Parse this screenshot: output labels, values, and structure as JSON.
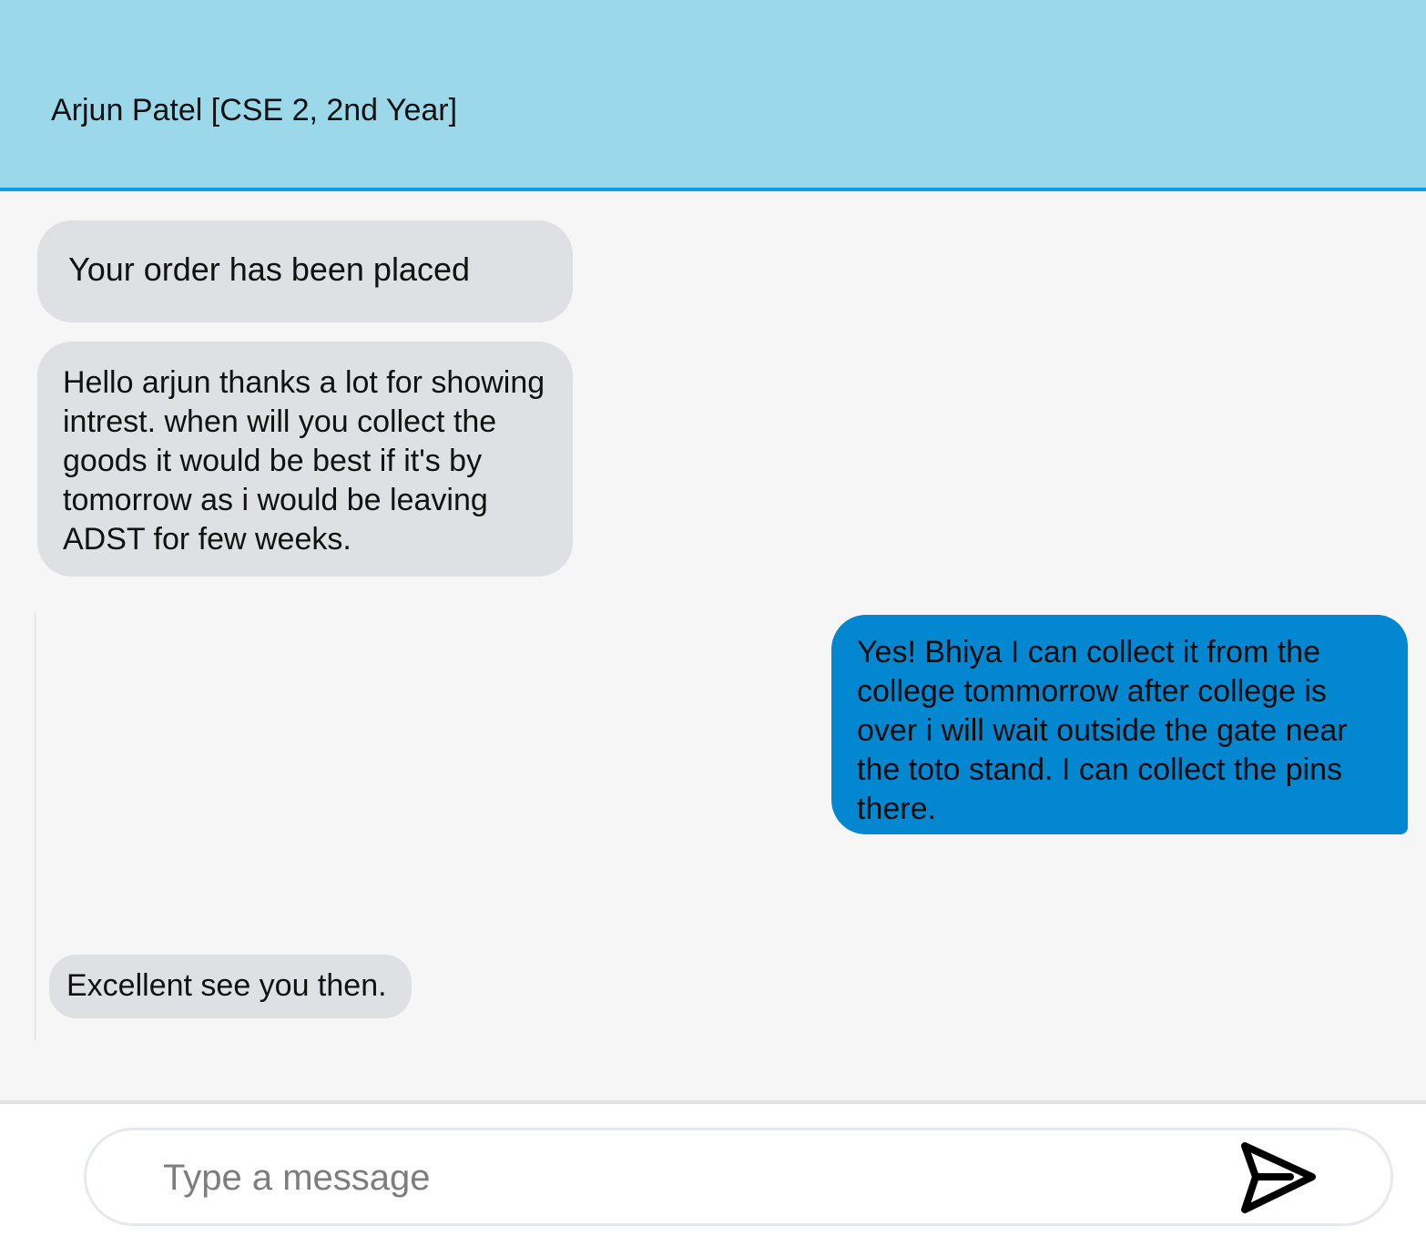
{
  "header": {
    "title": "Arjun Patel [CSE 2, 2nd Year]"
  },
  "messages": [
    {
      "direction": "incoming",
      "text": "Your order has been placed"
    },
    {
      "direction": "incoming",
      "text": "Hello arjun thanks a lot for showing intrest. when will you collect the goods it would be best if it's by tomorrow as i would be leaving ADST for few weeks."
    },
    {
      "direction": "outgoing",
      "text": "Yes! Bhiya I can collect it from the college tommorrow after college is over i will wait outside the gate near the toto stand. I can collect the pins there."
    },
    {
      "direction": "incoming",
      "text": "Excellent see you then."
    }
  ],
  "composer": {
    "placeholder": "Type a message",
    "value": "",
    "send_icon": "send-icon"
  },
  "colors": {
    "header_bg": "#9bd9ea",
    "header_border": "#0e9ee0",
    "incoming_bubble": "#dfe0e4",
    "outgoing_bubble": "#0287d0"
  }
}
